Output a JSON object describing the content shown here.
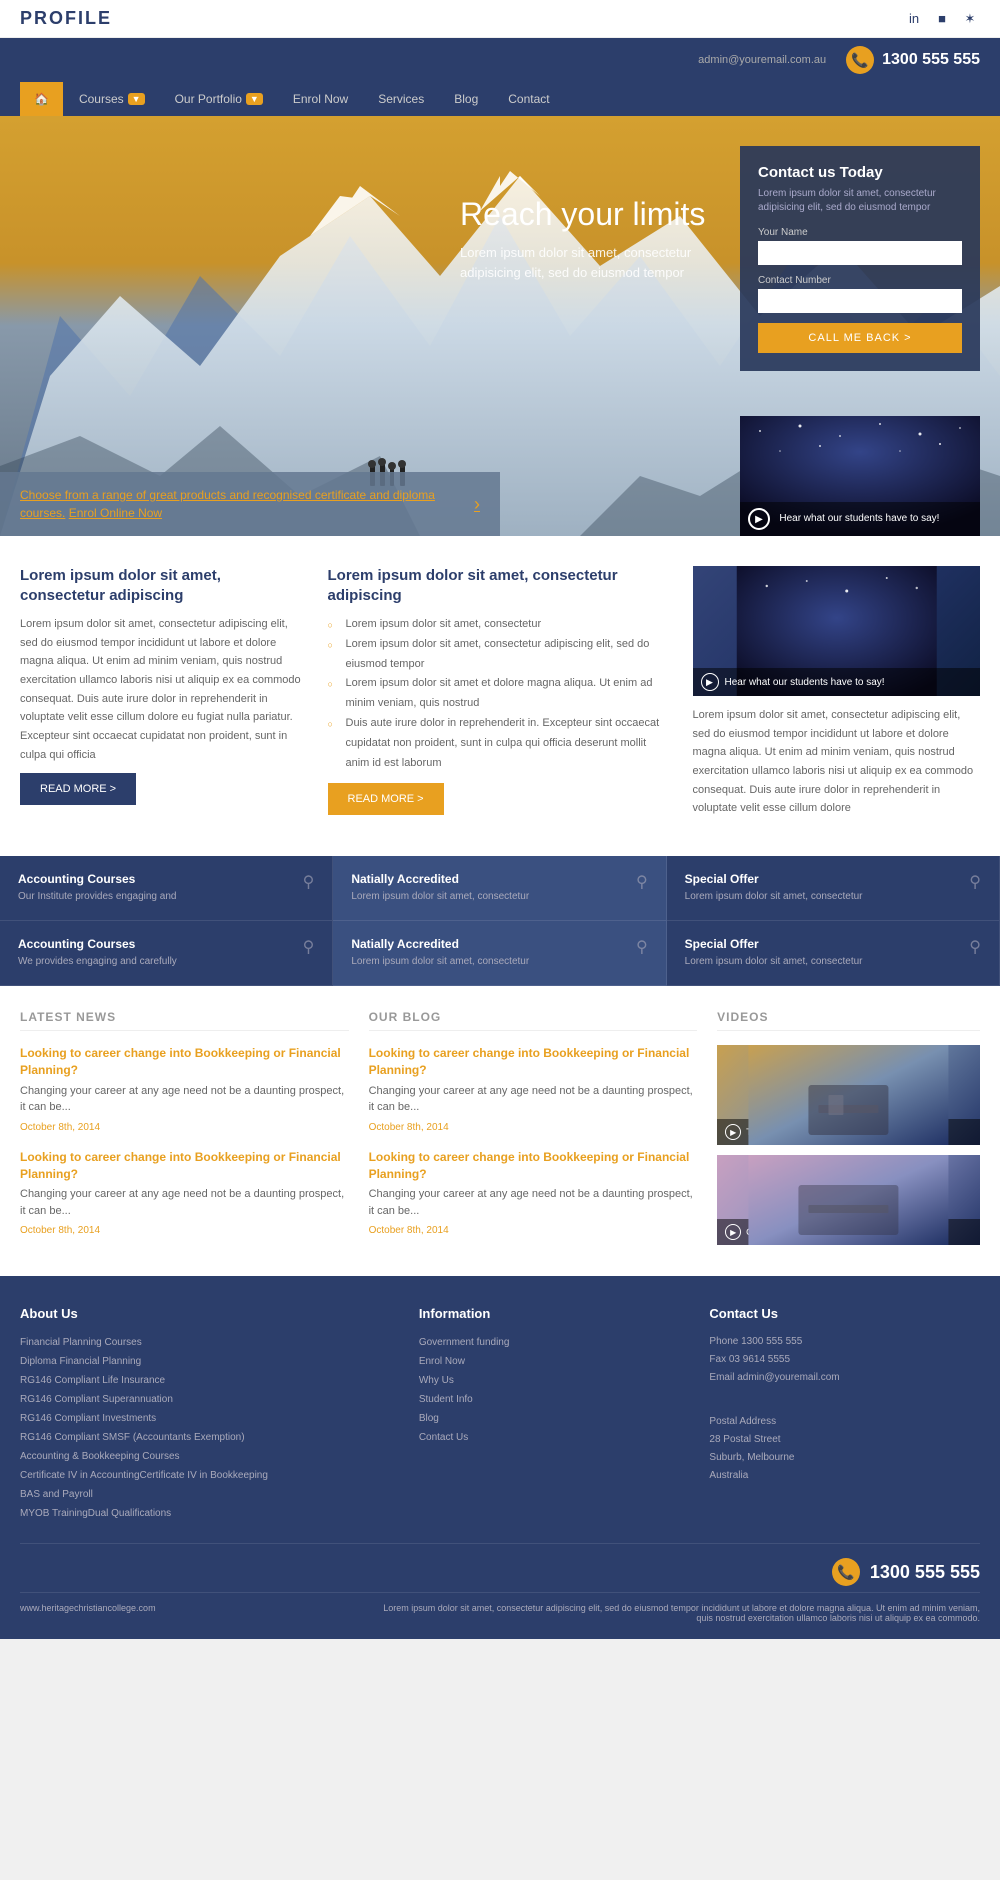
{
  "brand": {
    "logo": "PROFILE",
    "tagline": "www.heritagechristiancollege.com"
  },
  "social": {
    "icons": [
      "in",
      "f",
      "t"
    ]
  },
  "contact_bar": {
    "email": "admin@youremail.com.au",
    "phone": "1300 555 555"
  },
  "nav": {
    "home_icon": "🏠",
    "items": [
      {
        "label": "Courses",
        "has_dropdown": true
      },
      {
        "label": "Our Portfolio",
        "has_dropdown": true
      },
      {
        "label": "Enrol Now"
      },
      {
        "label": "Services"
      },
      {
        "label": "Blog"
      },
      {
        "label": "Contact"
      }
    ]
  },
  "hero": {
    "title": "Reach your limits",
    "subtitle": "Lorem ipsum dolor sit amet, consectetur adipisicing elit, sed do eiusmod tempor",
    "banner_text": "Choose from a range of great products and recognised certificate and diploma courses.",
    "banner_link": "Enrol Online Now",
    "video_label": "Hear what our students have to say!"
  },
  "contact_form": {
    "title": "Contact us Today",
    "description": "Lorem ipsum dolor sit amet, consectetur adipisicing elit, sed do eiusmod tempor",
    "name_label": "Your Name",
    "phone_label": "Contact Number",
    "button": "CALL ME BACK >"
  },
  "main": {
    "col1": {
      "title": "Lorem ipsum dolor sit amet, consectetur adipiscing",
      "body": "Lorem ipsum dolor sit amet, consectetur adipiscing elit, sed do eiusmod tempor incididunt ut labore et dolore magna aliqua. Ut enim ad minim veniam, quis nostrud exercitation ullamco laboris nisi ut aliquip ex ea commodo consequat. Duis aute irure dolor in reprehenderit in voluptate velit esse cillum dolore eu fugiat nulla pariatur. Excepteur sint occaecat cupidatat non proident, sunt in culpa qui officia",
      "btn": "READ MORE >"
    },
    "col2": {
      "title": "Lorem ipsum dolor sit amet, consectetur adipiscing",
      "items": [
        "Lorem ipsum dolor sit amet, consectetur",
        "Lorem ipsum dolor sit amet, consectetur adipiscing elit, sed do eiusmod tempor",
        "Lorem ipsum dolor sit amet et dolore magna aliqua. Ut enim ad minim veniam, quis nostrud",
        "Duis aute irure dolor in reprehenderit in. Excepteur sint occaecat cupidatat non proident, sunt in culpa qui officia deserunt mollit anim id est laborum"
      ],
      "btn": "READ MORE >"
    },
    "col3": {
      "body": "Lorem ipsum dolor sit amet, consectetur adipiscing elit, sed do eiusmod tempor incididunt ut labore et dolore magna aliqua. Ut enim ad minim veniam, quis nostrud exercitation ullamco laboris nisi ut aliquip ex ea commodo consequat. Duis aute irure dolor in reprehenderit in voluptate velit esse cillum dolore"
    }
  },
  "features": [
    {
      "title": "Accounting Courses",
      "desc": "Our Institute provides engaging and",
      "highlighted": false
    },
    {
      "title": "Natially Accredited",
      "desc": "Lorem ipsum dolor sit amet, consectetur",
      "highlighted": true
    },
    {
      "title": "Special Offer",
      "desc": "Lorem ipsum dolor sit amet, consectetur",
      "highlighted": false
    },
    {
      "title": "Accounting Courses",
      "desc": "We provides engaging and carefully",
      "highlighted": false
    },
    {
      "title": "Natially Accredited",
      "desc": "Lorem ipsum dolor sit amet, consectetur",
      "highlighted": true
    },
    {
      "title": "Special Offer",
      "desc": "Lorem ipsum dolor sit amet, consectetur",
      "highlighted": false
    }
  ],
  "news": {
    "section_title": "LATEST NEWS",
    "items": [
      {
        "title": "Looking to career change into Bookkeeping or Financial Planning?",
        "body": "Changing your career at any age need not be a daunting prospect, it can be...",
        "date": "October 8th, 2014"
      },
      {
        "title": "Looking to career change into Bookkeeping or Financial Planning?",
        "body": "Changing your career at any age need not be a daunting prospect, it can be...",
        "date": "October 8th, 2014"
      }
    ]
  },
  "blog": {
    "section_title": "OUR BLOG",
    "items": [
      {
        "title": "Looking to career change into Bookkeeping or Financial Planning?",
        "body": "Changing your career at any age need not be a daunting prospect, it can be...",
        "date": "October 8th, 2014"
      },
      {
        "title": "Looking to career change into Bookkeeping or Financial Planning?",
        "body": "Changing your career at any age need not be a daunting prospect, it can be...",
        "date": "October 8th, 2014"
      }
    ]
  },
  "videos": {
    "section_title": "VIDEOS",
    "items": [
      {
        "label": "Thinking of studying online?"
      },
      {
        "label": "Career options in Financial Planning!"
      }
    ]
  },
  "footer": {
    "about": {
      "title": "About Us",
      "links": [
        "Financial Planning Courses",
        "Diploma Financial Planning",
        "RG146 Compliant Life Insurance",
        "RG146 Compliant Superannuation",
        "RG146 Compliant Investments",
        "RG146 Compliant SMSF (Accountants Exemption)",
        "Accounting & Bookkeeping Courses",
        "Certificate IV in AccountingCertificate IV in Bookkeeping",
        "BAS and Payroll",
        "MYOB TrainingDual Qualifications"
      ]
    },
    "information": {
      "title": "Information",
      "links": [
        "Government funding",
        "Enrol Now",
        "Why Us",
        "Student Info",
        "Blog",
        "Contact Us"
      ]
    },
    "contact": {
      "title": "Contact Us",
      "phone": "Phone 1300 555 555",
      "fax": "Fax 03 9614 5555",
      "email": "Email admin@youremail.com",
      "postal_label": "Postal Address",
      "address1": "28 Postal Street",
      "address2": "Suburb, Melbourne",
      "address3": "Australia"
    },
    "phone_bar": "1300 555 555",
    "tagline": "www.heritagechristiancollege.com",
    "copyright": "Lorem ipsum dolor sit amet, consectetur adipiscing elit, sed do eiusmod tempor incididunt ut labore et dolore magna aliqua. Ut enim ad minim veniam, quis nostrud exercitation ullamco laboris nisi ut aliquip ex ea commodo."
  }
}
